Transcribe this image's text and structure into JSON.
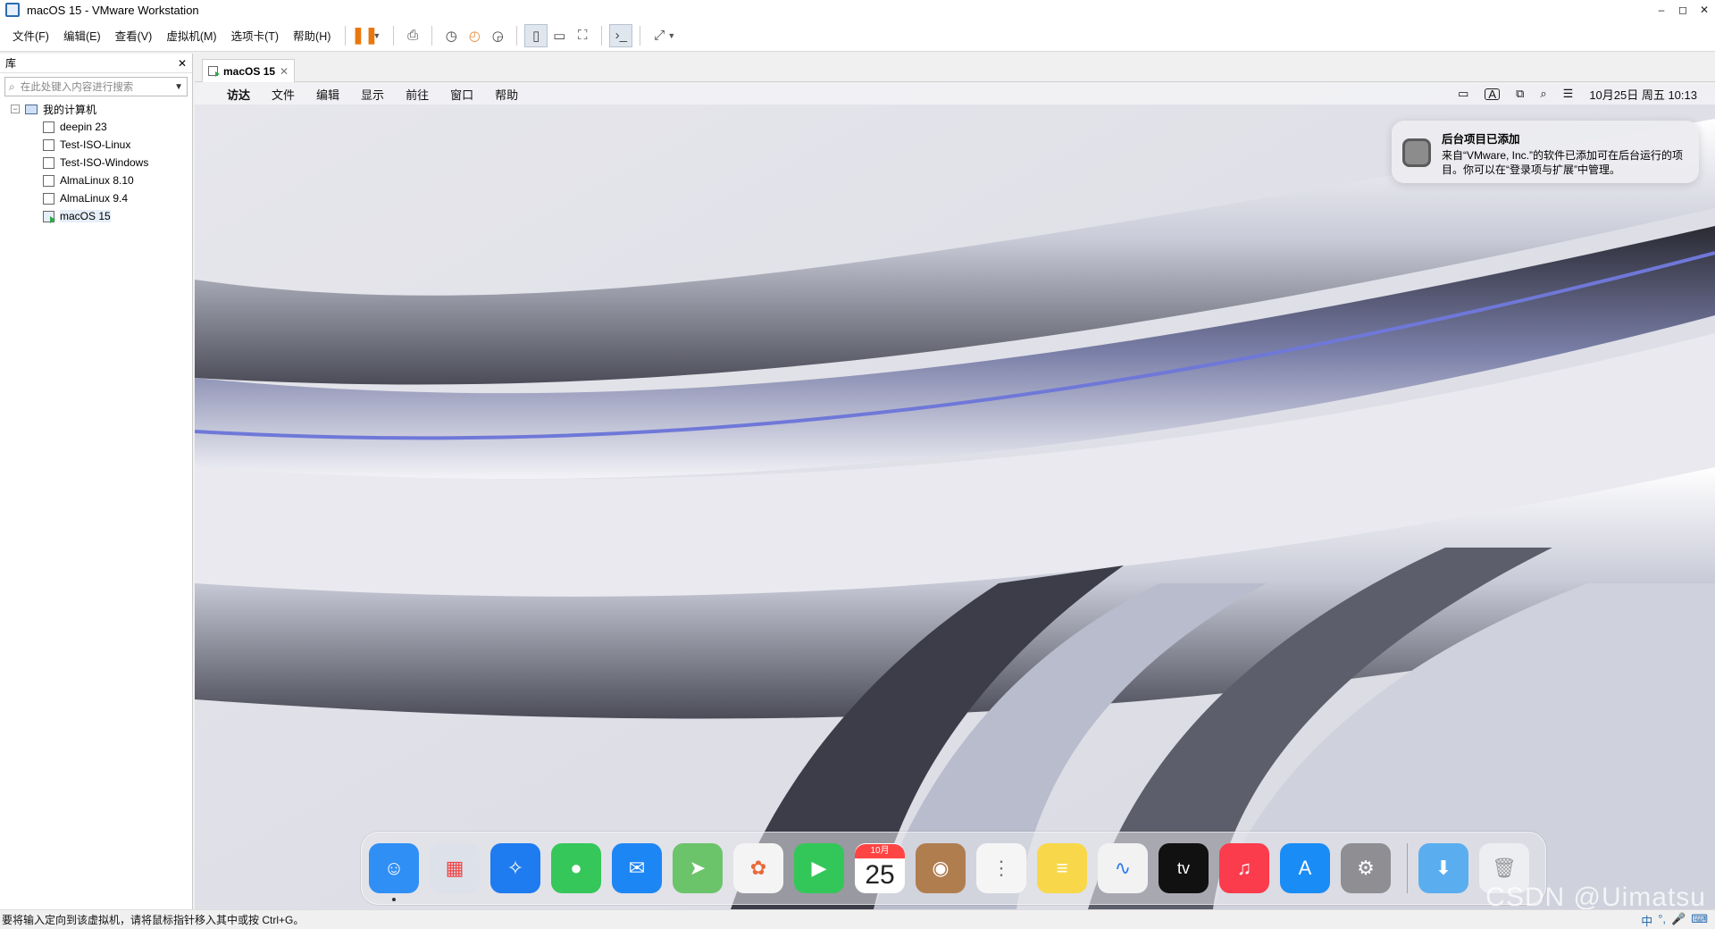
{
  "window": {
    "title": "macOS 15 - VMware Workstation",
    "minimize": "–",
    "maximize": "◻",
    "close": "✕"
  },
  "menu": [
    "文件(F)",
    "编辑(E)",
    "查看(V)",
    "虚拟机(M)",
    "选项卡(T)",
    "帮助(H)"
  ],
  "library": {
    "title": "库",
    "close": "✕",
    "search_placeholder": "在此处键入内容进行搜索",
    "root": "我的计算机",
    "vms": [
      "deepin 23",
      "Test-ISO-Linux",
      "Test-ISO-Windows",
      "AlmaLinux 8.10",
      "AlmaLinux 9.4",
      "macOS 15"
    ],
    "selected": "macOS 15"
  },
  "tab": {
    "label": "macOS 15",
    "close": "✕"
  },
  "mac": {
    "menu": [
      "访达",
      "文件",
      "编辑",
      "显示",
      "前往",
      "窗口",
      "帮助"
    ],
    "status": {
      "input_source": "A",
      "datetime": "10月25日 周五  10:13"
    }
  },
  "notification": {
    "title": "后台项目已添加",
    "body": "来自“VMware, Inc.”的软件已添加可在后台运行的项目。你可以在“登录项与扩展”中管理。"
  },
  "dock": {
    "apps": [
      {
        "name": "finder-icon",
        "color": "#2f8ff5"
      },
      {
        "name": "launchpad-icon",
        "color": "#dde1ea"
      },
      {
        "name": "safari-icon",
        "color": "#1e7bf0"
      },
      {
        "name": "messages-icon",
        "color": "#35c759"
      },
      {
        "name": "mail-icon",
        "color": "#1d86f5"
      },
      {
        "name": "maps-icon",
        "color": "#6cc46a"
      },
      {
        "name": "photos-icon",
        "color": "#f4f4f4"
      },
      {
        "name": "facetime-icon",
        "color": "#33c759"
      },
      {
        "name": "calendar-icon",
        "color": "#ffffff"
      },
      {
        "name": "contacts-icon",
        "color": "#b07d4f"
      },
      {
        "name": "reminders-icon",
        "color": "#f5f5f5"
      },
      {
        "name": "notes-icon",
        "color": "#f8d84a"
      },
      {
        "name": "freeform-icon",
        "color": "#f2f2f2"
      },
      {
        "name": "appletv-icon",
        "color": "#111111"
      },
      {
        "name": "music-icon",
        "color": "#fa3c4c"
      },
      {
        "name": "appstore-icon",
        "color": "#1a8cf5"
      },
      {
        "name": "system-settings-icon",
        "color": "#8e8e93"
      }
    ],
    "calendar_month": "10月",
    "calendar_day": "25",
    "tv_label": "tv"
  },
  "status_text": "要将输入定向到该虚拟机，请将鼠标指针移入其中或按 Ctrl+G。",
  "watermark": "CSDN @Uimatsu",
  "tray": [
    "中",
    "°,",
    "🎤",
    "⌨"
  ]
}
